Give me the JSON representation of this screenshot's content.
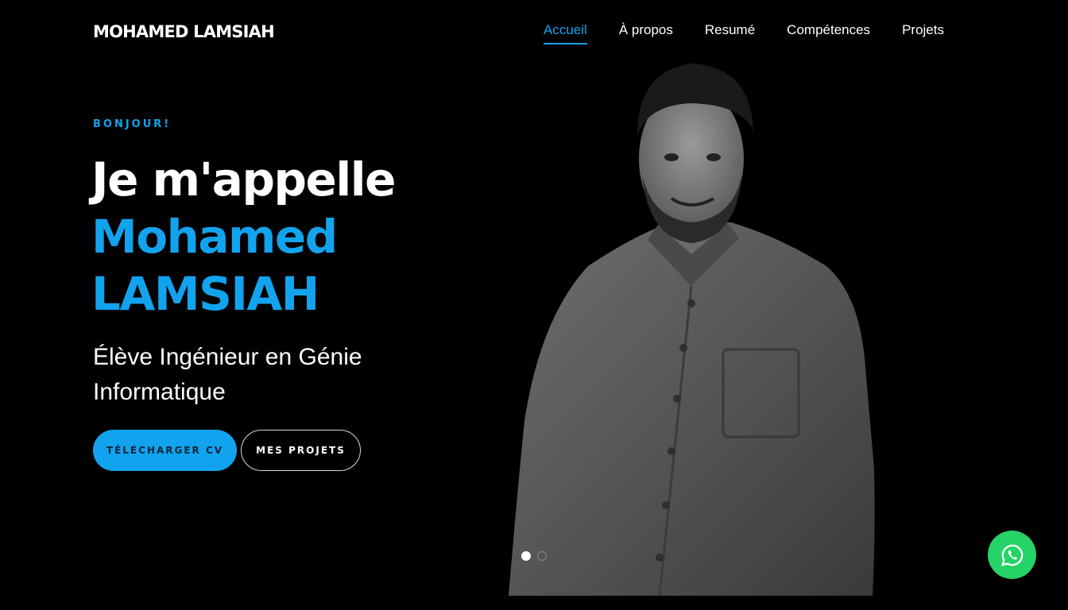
{
  "header": {
    "brand": "MOHAMED LAMSIAH",
    "nav": [
      {
        "label": "Accueil",
        "active": true
      },
      {
        "label": "À propos",
        "active": false
      },
      {
        "label": "Resumé",
        "active": false
      },
      {
        "label": "Compétences",
        "active": false
      },
      {
        "label": "Projets",
        "active": false
      }
    ]
  },
  "hero": {
    "greeting": "BONJOUR!",
    "headline_line1": "Je m'appelle",
    "headline_line2": "Mohamed",
    "headline_line3": "LAMSIAH",
    "subtitle": "Élève Ingénieur en Génie Informatique",
    "buttons": {
      "cv": "TÉLÉCHARGER CV",
      "projects": "MES PROJETS"
    },
    "slider": {
      "total": 2,
      "active_index": 0
    }
  },
  "colors": {
    "accent": "#12a3ee",
    "background": "#000000",
    "whatsapp": "#25d366"
  },
  "icons": {
    "floating_button": "whatsapp-icon"
  }
}
